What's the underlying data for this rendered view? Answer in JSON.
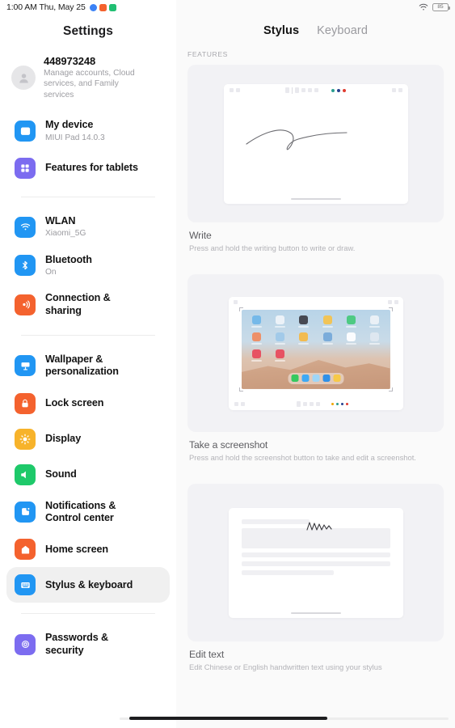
{
  "statusbar": {
    "clock": "1:00 AM Thu, May 25",
    "app_icons": [
      {
        "name": "app-icon-blue",
        "color": "#3b82f6",
        "shape": "round"
      },
      {
        "name": "app-icon-orange",
        "color": "#f4622e",
        "shape": "square"
      },
      {
        "name": "app-icon-green",
        "color": "#21bf73",
        "shape": "square"
      }
    ],
    "wifi_icon": "wifi-icon",
    "battery_level": "85"
  },
  "sidebar": {
    "title": "Settings",
    "account": {
      "name": "448973248",
      "subtitle": "Manage accounts, Cloud services, and Family services",
      "avatar_icon": "person-avatar-icon"
    },
    "groups": [
      {
        "items": [
          {
            "label": "My device",
            "sub": "MIUI Pad 14.0.3",
            "icon": "tablet-icon",
            "color": "#2196f3",
            "selected": false
          },
          {
            "label": "Features for tablets",
            "sub": "",
            "icon": "grid-dots-icon",
            "color": "#7c6cf0",
            "selected": false
          }
        ]
      },
      {
        "items": [
          {
            "label": "WLAN",
            "sub": "Xiaomi_5G",
            "icon": "wifi-icon",
            "color": "#2196f3",
            "selected": false
          },
          {
            "label": "Bluetooth",
            "sub": "On",
            "icon": "bluetooth-icon",
            "color": "#2196f3",
            "selected": false
          },
          {
            "label": "Connection & sharing",
            "sub": "",
            "icon": "connection-sharing-icon",
            "color": "#f4622e",
            "selected": false
          }
        ]
      },
      {
        "items": [
          {
            "label": "Wallpaper & personalization",
            "sub": "",
            "icon": "wallpaper-icon",
            "color": "#2196f3",
            "selected": false
          },
          {
            "label": "Lock screen",
            "sub": "",
            "icon": "lock-icon",
            "color": "#f4622e",
            "selected": false
          },
          {
            "label": "Display",
            "sub": "",
            "icon": "brightness-icon",
            "color": "#f7b32b",
            "selected": false
          },
          {
            "label": "Sound",
            "sub": "",
            "icon": "speaker-icon",
            "color": "#1ec96a",
            "selected": false
          },
          {
            "label": "Notifications & Control center",
            "sub": "",
            "icon": "notifications-icon",
            "color": "#2196f3",
            "selected": false
          },
          {
            "label": "Home screen",
            "sub": "",
            "icon": "home-icon",
            "color": "#f4622e",
            "selected": false
          },
          {
            "label": "Stylus & keyboard",
            "sub": "",
            "icon": "keyboard-icon",
            "color": "#2196f3",
            "selected": true
          }
        ]
      },
      {
        "items": [
          {
            "label": "Passwords & security",
            "sub": "",
            "icon": "fingerprint-shield-icon",
            "color": "#7c6cf0",
            "selected": false
          }
        ]
      }
    ]
  },
  "panel": {
    "tabs": [
      {
        "label": "Stylus",
        "active": true
      },
      {
        "label": "Keyboard",
        "active": false
      }
    ],
    "section_label": "FEATURES",
    "features": [
      {
        "title": "Write",
        "subtitle": "Press and hold the writing button to write or draw.",
        "illustration": "note-app-handwriting-illustration"
      },
      {
        "title": "Take a screenshot",
        "subtitle": "Press and hold the screenshot button to take and edit a screenshot.",
        "illustration": "screenshot-crop-homescreen-illustration"
      },
      {
        "title": "Edit text",
        "subtitle": "Edit Chinese or English handwritten text using your stylus",
        "illustration": "handwritten-text-editing-illustration"
      }
    ],
    "toolbar_dots": [
      "#2a9d8f",
      "#26418f",
      "#e03b2f"
    ],
    "dock_icons": [
      "#36c95f",
      "#3ea9f5",
      "#9fd6f7",
      "#2f90e8",
      "#f7c948"
    ],
    "app_grid_colors": [
      "#6fb6e8",
      "#f0f4f8",
      "#3d3d44",
      "#f5c24a",
      "#44c97a",
      "#eef2f6",
      "#f08a5d",
      "#9ec9e8",
      "#f5b942",
      "#74a8d8",
      "#ffffff",
      "#dfe8f0",
      "#e8485a",
      "#e8485a"
    ]
  }
}
